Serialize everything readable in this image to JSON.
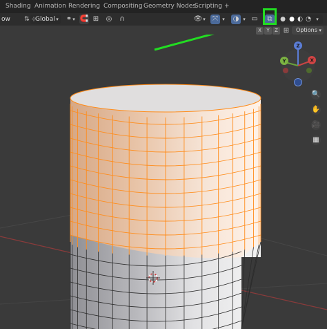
{
  "workspace_tabs": [
    {
      "label": "Shading"
    },
    {
      "label": "Animation"
    },
    {
      "label": "Rendering"
    },
    {
      "label": "Compositing"
    },
    {
      "label": "Geometry Nodes"
    },
    {
      "label": "Scripting"
    },
    {
      "label": "+"
    }
  ],
  "header": {
    "view_fragment": "ow",
    "transform_orientation": "Global",
    "options_label": "Options"
  },
  "axis_toggles": [
    "X",
    "Y",
    "Z"
  ],
  "gizmo": {
    "x": "X",
    "y": "Y",
    "z": "Z"
  },
  "annotation": {
    "highlight_color": "#22dd22",
    "arrow_color": "#22dd22",
    "target": "toggle-xray-button"
  },
  "colors": {
    "selected_edges": "#ff8c1a",
    "mesh_face": "#c8c8c8",
    "viewport_bg": "#3a3a3a"
  },
  "icons": {
    "zoom": "magnifier-plus-icon",
    "pan": "hand-icon",
    "camera": "camera-icon",
    "ortho": "grid-icon"
  }
}
